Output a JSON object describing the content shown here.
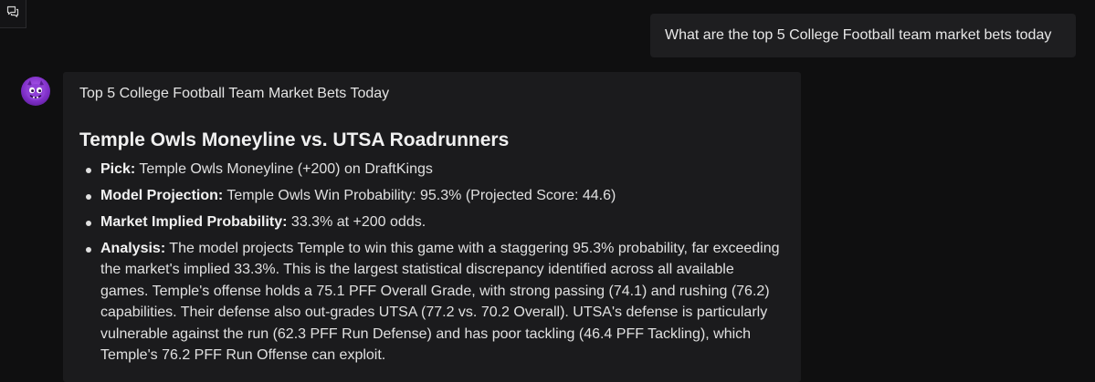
{
  "corner": {
    "icon": "chat-bubbles-icon"
  },
  "user_message": {
    "text": "What are the top 5 College Football team market bets today"
  },
  "assistant": {
    "avatar_icon": "purple-monster-avatar",
    "intro": "Top 5 College Football Team Market Bets Today",
    "heading": "Temple Owls Moneyline vs. UTSA Roadrunners",
    "points": [
      {
        "label": "Pick:",
        "text": " Temple Owls Moneyline (+200) on DraftKings"
      },
      {
        "label": "Model Projection:",
        "text": " Temple Owls Win Probability: 95.3% (Projected Score: 44.6)"
      },
      {
        "label": "Market Implied Probability:",
        "text": " 33.3% at +200 odds."
      },
      {
        "label": "Analysis:",
        "text": " The model projects Temple to win this game with a staggering 95.3% probability, far exceeding the market's implied 33.3%. This is the largest statistical discrepancy identified across all available games. Temple's offense holds a 75.1 PFF Overall Grade, with strong passing (74.1) and rushing (76.2) capabilities. Their defense also out-grades UTSA (77.2 vs. 70.2 Overall). UTSA's defense is particularly vulnerable against the run (62.3 PFF Run Defense) and has poor tackling (46.4 PFF Tackling), which Temple's 76.2 PFF Run Offense can exploit."
      }
    ]
  }
}
